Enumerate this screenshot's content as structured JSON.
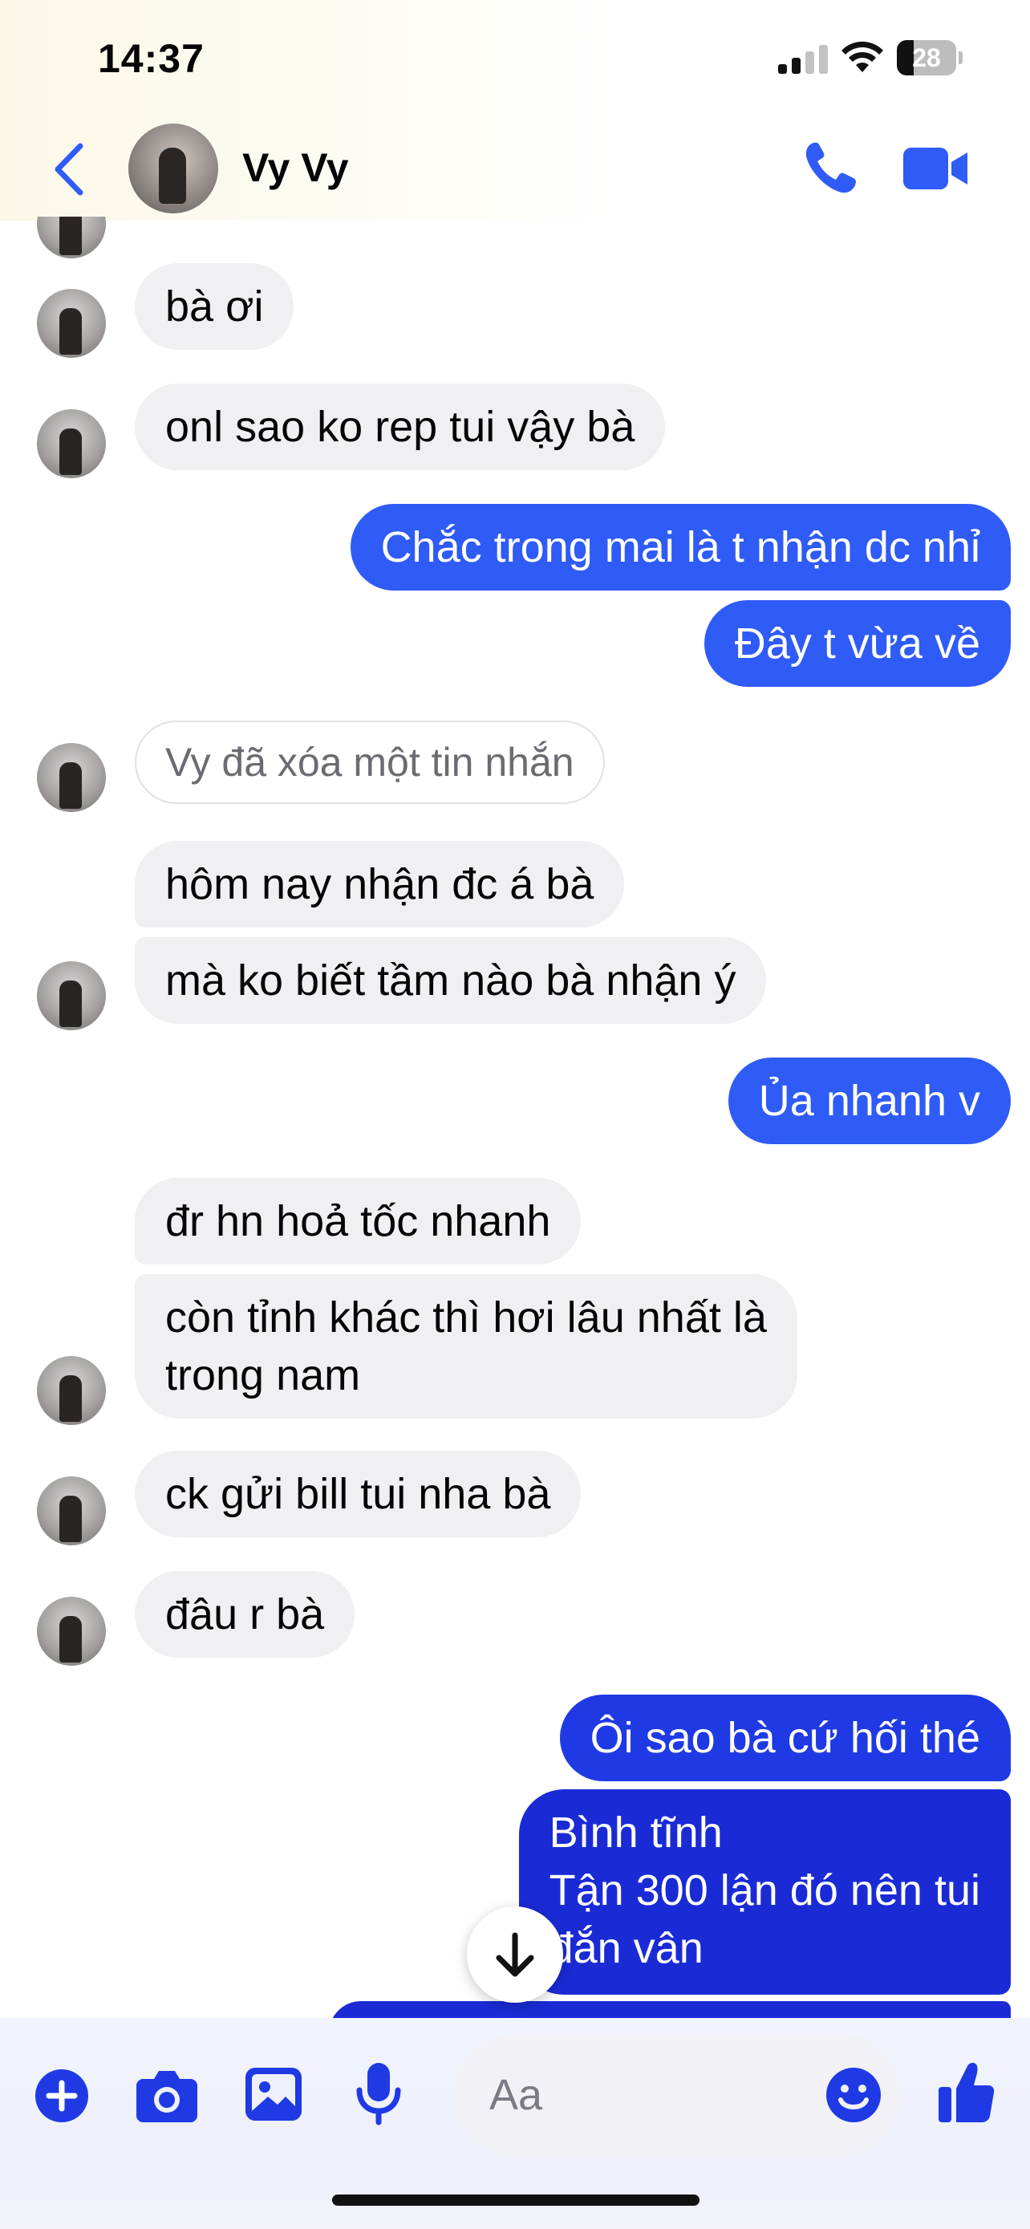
{
  "status_bar": {
    "time": "14:37",
    "battery": "28",
    "battery_level": 0.28
  },
  "header": {
    "contact_name": "Vy Vy",
    "back_icon": "chevron-left-icon",
    "call_icon": "phone-icon",
    "video_icon": "video-camera-icon"
  },
  "colors": {
    "accent": "#2f5bf6",
    "outgoing_bubble": "#2f5bf6",
    "outgoing_bubble_deep": "#1a2bd6",
    "incoming_bubble": "#f0f0f3"
  },
  "messages": [
    {
      "direction": "in",
      "text": "bà ơi"
    },
    {
      "direction": "in",
      "text": "onl sao ko rep tui vậy bà"
    },
    {
      "direction": "out",
      "text": "Chắc trong mai là t nhận dc nhỉ"
    },
    {
      "direction": "out",
      "text": "Đây t vừa về"
    },
    {
      "direction": "in",
      "text": "Vy đã xóa một tin nhắn",
      "deleted": true
    },
    {
      "direction": "in",
      "text": "hôm nay nhận đc á bà"
    },
    {
      "direction": "in",
      "text": "mà ko biết tầm nào bà nhận ý"
    },
    {
      "direction": "out",
      "text": "Ủa nhanh v"
    },
    {
      "direction": "in",
      "text": "đr hn hoả tốc nhanh"
    },
    {
      "direction": "in",
      "lines": [
        "còn tỉnh khác thì hơi lâu nhất là",
        "trong nam"
      ]
    },
    {
      "direction": "in",
      "text": "ck gửi bill tui nha bà"
    },
    {
      "direction": "in",
      "text": "đâu r bà"
    },
    {
      "direction": "out",
      "text": "Ôi sao bà cứ hối thé"
    },
    {
      "direction": "out",
      "lines": [
        "Bình tĩnh",
        "Tận 300 lận đó nên tui",
        "đắn vân"
      ]
    }
  ],
  "composer": {
    "placeholder": "Aa",
    "icons": [
      "plus-icon",
      "camera-icon",
      "image-icon",
      "microphone-icon",
      "emoji-icon",
      "thumbs-up-icon"
    ]
  },
  "scroll_down_icon": "arrow-down-icon"
}
